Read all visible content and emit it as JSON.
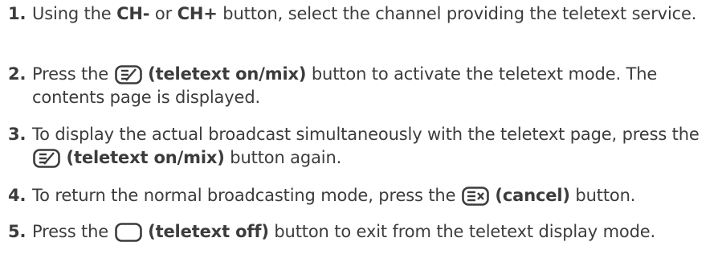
{
  "steps": [
    {
      "number": "1.",
      "parts": {
        "a": "Using the ",
        "b": "CH-",
        "c": " or ",
        "d": "CH+",
        "e": " button, select the channel providing the teletext service."
      }
    },
    {
      "number": "2.",
      "icon": "teletext-on-mix-icon",
      "parts": {
        "a": "Press the ",
        "b": "(teletext on/mix)",
        "c": " button to activate the teletext mode. The contents page is displayed."
      }
    },
    {
      "number": "3.",
      "icon": "teletext-on-mix-icon",
      "parts": {
        "a": "To display the actual broadcast simultaneously with the teletext page, press the ",
        "b": "(teletext on/mix)",
        "c": " button again."
      }
    },
    {
      "number": "4.",
      "icon": "cancel-icon",
      "parts": {
        "a": "To return the normal broadcasting mode, press the ",
        "b": "(cancel)",
        "c": " button."
      }
    },
    {
      "number": "5.",
      "icon": "teletext-off-icon",
      "parts": {
        "a": "Press the ",
        "b": "(teletext off)",
        "c": " button to exit from the teletext display mode."
      }
    }
  ]
}
